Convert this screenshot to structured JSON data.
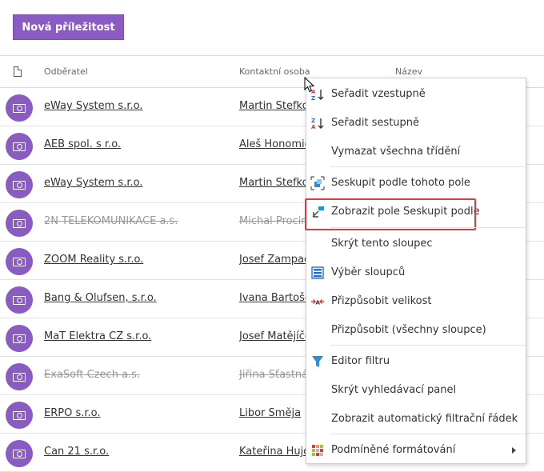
{
  "toolbar": {
    "new_button_label": "Nová příležitost"
  },
  "grid": {
    "columns": [
      "Odběratel",
      "Kontaktní osoba",
      "Název"
    ],
    "rows": [
      {
        "customer": "eWay System s.r.o.",
        "contact": "Martin Štefko",
        "strike": false
      },
      {
        "customer": "AEB spol. s r.o.",
        "contact": "Aleš Honomic",
        "strike": false
      },
      {
        "customer": "eWay System s.r.o.",
        "contact": "Martin Štefko",
        "strike": false
      },
      {
        "customer": "2N TELEKOMUNIKACE a.s.",
        "contact": "Michal Procin",
        "strike": true
      },
      {
        "customer": "ZOOM Reality s.r.o.",
        "contact": "Josef Žampach",
        "strike": false
      },
      {
        "customer": "Bang & Olufsen, s.r.o.",
        "contact": "Ivana Bartošo",
        "strike": false
      },
      {
        "customer": "MaT Elektra CZ s.r.o.",
        "contact": "Josef Matějíče",
        "strike": false
      },
      {
        "customer": "ExaSoft Czech a.s.",
        "contact": "Jiřina Šťastná",
        "strike": true
      },
      {
        "customer": "ERPO s.r.o.",
        "contact": "Libor Směja",
        "strike": false
      },
      {
        "customer": "Can 21 s.r.o.",
        "contact": "Kateřina Hujd",
        "strike": false
      }
    ]
  },
  "context_menu": {
    "items": [
      {
        "label": "Seřadit vzestupně",
        "icon": "sort-ascending-icon"
      },
      {
        "label": "Seřadit sestupně",
        "icon": "sort-descending-icon"
      },
      {
        "label": "Vymazat všechna třídění",
        "icon": ""
      },
      {
        "label": "Seskupit podle tohoto pole",
        "icon": "group-by-icon"
      },
      {
        "label": "Zobrazit pole Seskupit podle",
        "icon": "group-panel-icon"
      },
      {
        "label": "Skrýt tento sloupec",
        "icon": ""
      },
      {
        "label": "Výběr sloupců",
        "icon": "column-chooser-icon"
      },
      {
        "label": "Přizpůsobit velikost",
        "icon": "best-fit-icon"
      },
      {
        "label": "Přizpůsobit (všechny sloupce)",
        "icon": ""
      },
      {
        "label": "Editor filtru",
        "icon": "filter-icon"
      },
      {
        "label": "Skrýt vyhledávací panel",
        "icon": ""
      },
      {
        "label": "Zobrazit automatický filtrační řádek",
        "icon": ""
      },
      {
        "label": "Podmíněné formátování",
        "icon": "conditional-formatting-icon"
      }
    ]
  },
  "colors": {
    "accent": "#8a5cc2",
    "highlight": "#e23a3a",
    "filter_blue": "#2a8fd6"
  }
}
